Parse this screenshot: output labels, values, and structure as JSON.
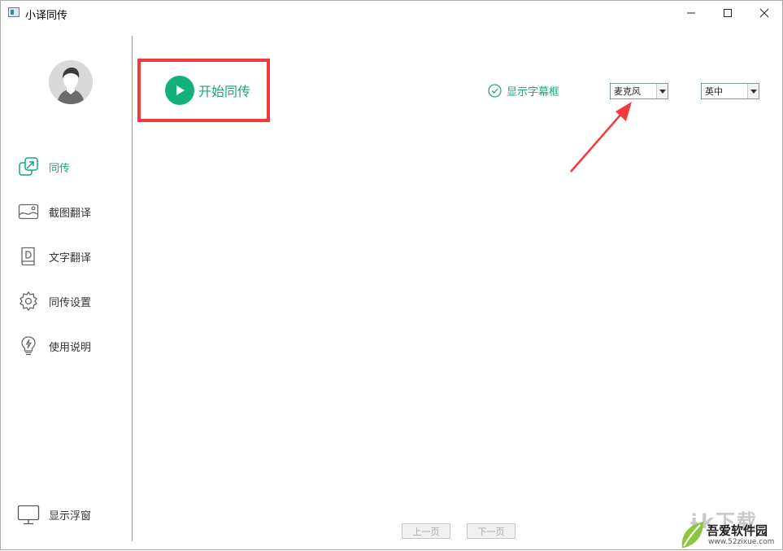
{
  "window": {
    "title": "小译同传"
  },
  "sidebar": {
    "items": [
      {
        "label": "同传",
        "icon": "share-window-icon",
        "active": true
      },
      {
        "label": "截图翻译",
        "icon": "image-icon",
        "active": false
      },
      {
        "label": "文字翻译",
        "icon": "document-icon",
        "active": false
      },
      {
        "label": "同传设置",
        "icon": "gear-icon",
        "active": false
      },
      {
        "label": "使用说明",
        "icon": "lightbulb-icon",
        "active": false
      }
    ],
    "bottom_item": {
      "label": "显示浮窗",
      "icon": "monitor-icon"
    }
  },
  "main": {
    "start_label": "开始同传",
    "subtitle_toggle_label": "显示字幕框",
    "input_source": {
      "selected": "麦克风"
    },
    "language_pair": {
      "selected": "英中"
    },
    "pager": {
      "prev_label": "上一页",
      "next_label": "下一页"
    }
  },
  "watermark": {
    "top": "ɨk下载",
    "name": "吾爱软件园",
    "url": "www.52zixue.com"
  },
  "colors": {
    "accent": "#18a67a",
    "highlight": "#f23a3a"
  }
}
